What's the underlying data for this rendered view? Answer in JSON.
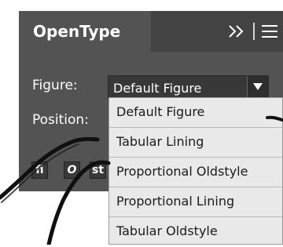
{
  "panel": {
    "tab_title": "OpenType",
    "collapse_icon": "double-chevron-right",
    "menu_icon": "hamburger-menu"
  },
  "figure": {
    "label": "Figure:",
    "selected": "Default Figure",
    "options": [
      "Default Figure",
      "Tabular Lining",
      "Proportional Oldstyle",
      "Proportional Lining",
      "Tabular Oldstyle"
    ]
  },
  "position": {
    "label": "Position:"
  },
  "glyph_buttons": [
    "fi",
    "O",
    "st"
  ]
}
